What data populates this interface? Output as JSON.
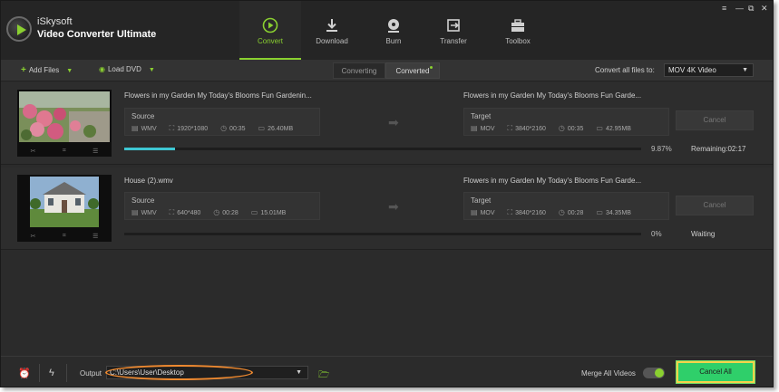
{
  "app": {
    "brand_line1": "iSkysoft",
    "brand_line2": "Video Converter Ultimate"
  },
  "nav": [
    {
      "label": "Convert",
      "icon": "convert-icon",
      "active": true
    },
    {
      "label": "Download",
      "icon": "download-icon",
      "active": false
    },
    {
      "label": "Burn",
      "icon": "burn-icon",
      "active": false
    },
    {
      "label": "Transfer",
      "icon": "transfer-icon",
      "active": false
    },
    {
      "label": "Toolbox",
      "icon": "toolbox-icon",
      "active": false
    }
  ],
  "window_controls": [
    "≡",
    "—",
    "⧉",
    "✕"
  ],
  "toolbar": {
    "add_files": "Add Files",
    "load_dvd": "Load DVD",
    "tab_converting": "Converting",
    "tab_converted": "Converted",
    "convert_all_label": "Convert all files to:",
    "format": "MOV 4K Video"
  },
  "items": [
    {
      "source_title": "Flowers in my Garden  My Today's Blooms  Fun Gardenin...",
      "target_title": "Flowers in my Garden  My Today's Blooms  Fun Garde...",
      "source": {
        "label": "Source",
        "format": "WMV",
        "resolution": "1920*1080",
        "duration": "00:35",
        "size": "26.40MB"
      },
      "target": {
        "label": "Target",
        "format": "MOV",
        "resolution": "3840*2160",
        "duration": "00:35",
        "size": "42.95MB"
      },
      "progress_percent": 9.87,
      "progress_text": "9.87%",
      "status": "Remaining:02:17",
      "cancel": "Cancel"
    },
    {
      "source_title": "House (2).wmv",
      "target_title": "Flowers in my Garden  My Today's Blooms  Fun Garde...",
      "source": {
        "label": "Source",
        "format": "WMV",
        "resolution": "640*480",
        "duration": "00:28",
        "size": "15.01MB"
      },
      "target": {
        "label": "Target",
        "format": "MOV",
        "resolution": "3840*2160",
        "duration": "00:28",
        "size": "34.35MB"
      },
      "progress_percent": 0,
      "progress_text": "0%",
      "status": "Waiting",
      "cancel": "Cancel"
    }
  ],
  "footer": {
    "output_label": "Output",
    "output_path": "C:\\Users\\User\\Desktop",
    "merge_label": "Merge All Videos",
    "merge_enabled": true,
    "cancel_all": "Cancel All"
  },
  "colors": {
    "accent": "#8ad030",
    "progress": "#3ec7d3",
    "highlight": "#f08a30",
    "cancel_all_bg": "#2fcf6a"
  }
}
